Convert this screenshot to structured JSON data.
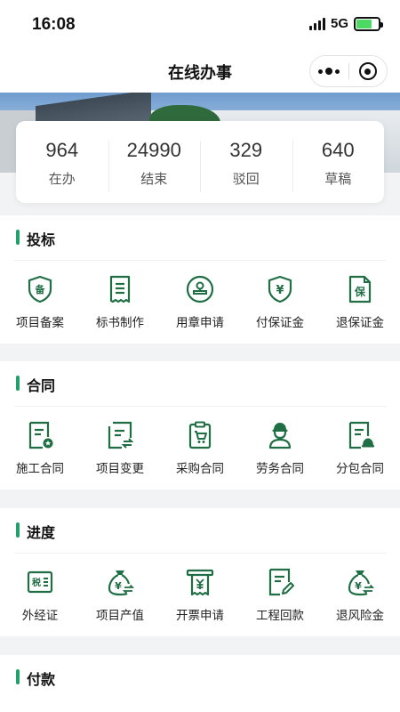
{
  "status_bar": {
    "time": "16:08",
    "network": "5G"
  },
  "nav": {
    "title": "在线办事"
  },
  "stats": [
    {
      "value": "964",
      "label": "在办"
    },
    {
      "value": "24990",
      "label": "结束"
    },
    {
      "value": "329",
      "label": "驳回"
    },
    {
      "value": "640",
      "label": "草稿"
    }
  ],
  "sections": {
    "bidding": {
      "title": "投标",
      "items": [
        {
          "label": "项目备案",
          "icon": "filing-shield-icon"
        },
        {
          "label": "标书制作",
          "icon": "document-icon"
        },
        {
          "label": "用章申请",
          "icon": "seal-icon"
        },
        {
          "label": "付保证金",
          "icon": "yuan-shield-icon"
        },
        {
          "label": "退保证金",
          "icon": "refund-doc-icon"
        }
      ]
    },
    "contract": {
      "title": "合同",
      "items": [
        {
          "label": "施工合同",
          "icon": "construction-contract-icon"
        },
        {
          "label": "项目变更",
          "icon": "change-doc-icon"
        },
        {
          "label": "采购合同",
          "icon": "cart-icon"
        },
        {
          "label": "劳务合同",
          "icon": "worker-icon"
        },
        {
          "label": "分包合同",
          "icon": "helmet-doc-icon"
        }
      ]
    },
    "progress": {
      "title": "进度",
      "items": [
        {
          "label": "外经证",
          "icon": "tax-card-icon"
        },
        {
          "label": "项目产值",
          "icon": "money-bag-icon"
        },
        {
          "label": "开票申请",
          "icon": "invoice-icon"
        },
        {
          "label": "工程回款",
          "icon": "edit-doc-icon"
        },
        {
          "label": "退风险金",
          "icon": "money-bag-refund-icon"
        }
      ]
    },
    "payment": {
      "title": "付款"
    }
  },
  "colors": {
    "accent": "#22a06b",
    "icon": "#1f6e44"
  }
}
